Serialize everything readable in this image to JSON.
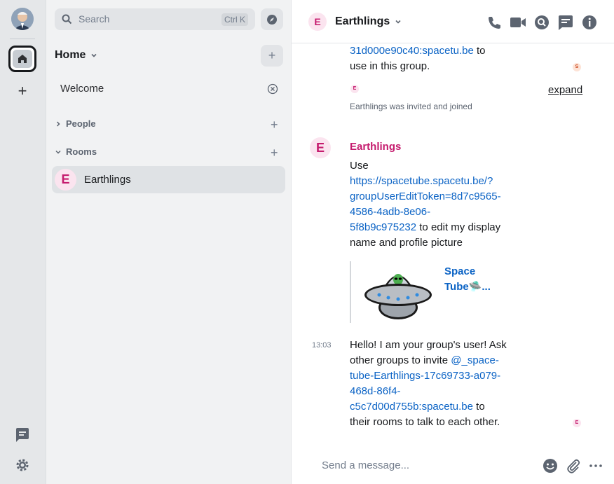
{
  "rail": {
    "avatar_label": "User avatar"
  },
  "search": {
    "placeholder": "Search",
    "shortcut": "Ctrl K"
  },
  "roomlist": {
    "space_title": "Home",
    "welcome_label": "Welcome",
    "sections": [
      {
        "label": "People"
      },
      {
        "label": "Rooms"
      }
    ],
    "rooms": [
      {
        "avatar_letter": "E",
        "name": "Earthlings"
      }
    ]
  },
  "header": {
    "avatar_letter": "E",
    "room_name": "Earthlings"
  },
  "timeline": {
    "prev_msg": {
      "link_part": "31d000e90c40:spacetu.be",
      "after_link": " to",
      "line2": "use in this group."
    },
    "read_receipt_1": "S",
    "event_avatar_letter": "E",
    "expand_label": "expand",
    "joined_text": "Earthlings was invited and joined",
    "message1": {
      "avatar_letter": "E",
      "sender": "Earthlings",
      "line1": "Use",
      "link_lines": [
        "https://spacetube.spacetu.be/?",
        "groupUserEditToken=8d7c9565-",
        "4586-4adb-8e06-",
        "5f8b9c975232"
      ],
      "after_link": " to edit my display",
      "last_line": "name and profile picture",
      "preview_title_line1": "Space",
      "preview_title_line2": "Tube🛸..."
    },
    "message2": {
      "timestamp": "13:03",
      "line1": "Hello! I am your group's user! Ask",
      "line2_pre": "other groups to invite ",
      "link_lines": [
        "@_space-",
        "tube-Earthlings-17c69733-a079-",
        "468d-86f4-",
        "c5c7d00d755b:spacetu.be"
      ],
      "after_link": " to",
      "last_line": "their rooms to talk to each other."
    },
    "read_receipt_2": "E"
  },
  "composer": {
    "placeholder": "Send a message..."
  },
  "colors": {
    "accent": "#0b63c5",
    "sender": "#c51b6e",
    "avatar_bg": "#fbe4ef"
  }
}
